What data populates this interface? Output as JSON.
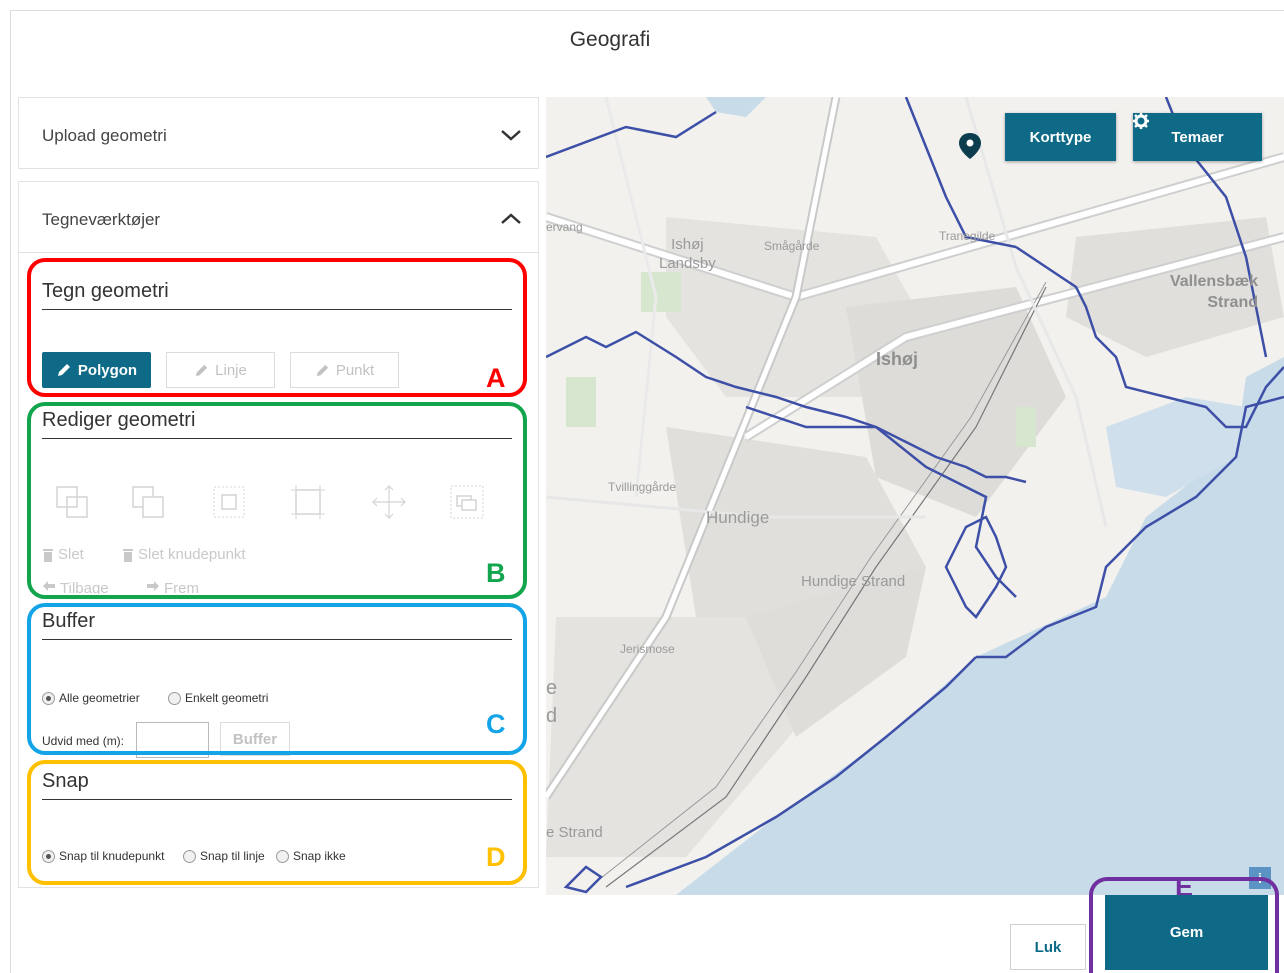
{
  "dialog": {
    "title": "Geografi"
  },
  "accordion": {
    "upload": {
      "label": "Upload geometri"
    },
    "tools": {
      "label": "Tegneværktøjer"
    }
  },
  "draw": {
    "title": "Tegn geometri",
    "buttons": {
      "polygon": "Polygon",
      "line": "Linje",
      "point": "Punkt"
    }
  },
  "edit": {
    "title": "Rediger geometri",
    "delete": "Slet",
    "delete_vertex": "Slet knudepunkt",
    "undo": "Tilbage",
    "redo": "Frem"
  },
  "buffer": {
    "title": "Buffer",
    "option_all": "Alle geometrier",
    "option_single": "Enkelt geometri",
    "extend_label": "Udvid med (m):",
    "input_value": "",
    "button": "Buffer"
  },
  "snap": {
    "title": "Snap",
    "option_vertex": "Snap til knudepunkt",
    "option_line": "Snap til linje",
    "option_none": "Snap ikke"
  },
  "annotations": {
    "a": "A",
    "b": "B",
    "c": "C",
    "d": "D",
    "e": "E"
  },
  "map": {
    "labels": {
      "ervang": "ervang",
      "ishoj_landsby": "Ishøj\nLandsby",
      "smagarde": "Smågårde",
      "tranegilde": "Tranegilde",
      "vallensbaek": "Vallensbæk\nStrand",
      "ishoj": "Ishøj",
      "tvillinggarde": "Tvillinggårde",
      "hundige": "Hundige",
      "hundige_strand": "Hundige Strand",
      "jerismose": "Jerismose",
      "edge_e": "e",
      "edge_d": "d",
      "edge_strand": "e Strand"
    },
    "korttype_button": "Korttype",
    "temaer_button": "Temaer",
    "info_button": "i"
  },
  "footer": {
    "close_button": "Luk",
    "save_button": "Gem"
  },
  "colors": {
    "primary": "#0e6a86",
    "frame_a": "#ff0000",
    "frame_b": "#13a54d",
    "frame_c": "#13a4e8",
    "frame_d": "#ffc000",
    "frame_e": "#7030a0",
    "water": "#c8dbe9",
    "boundary": "#3d4fa6"
  }
}
